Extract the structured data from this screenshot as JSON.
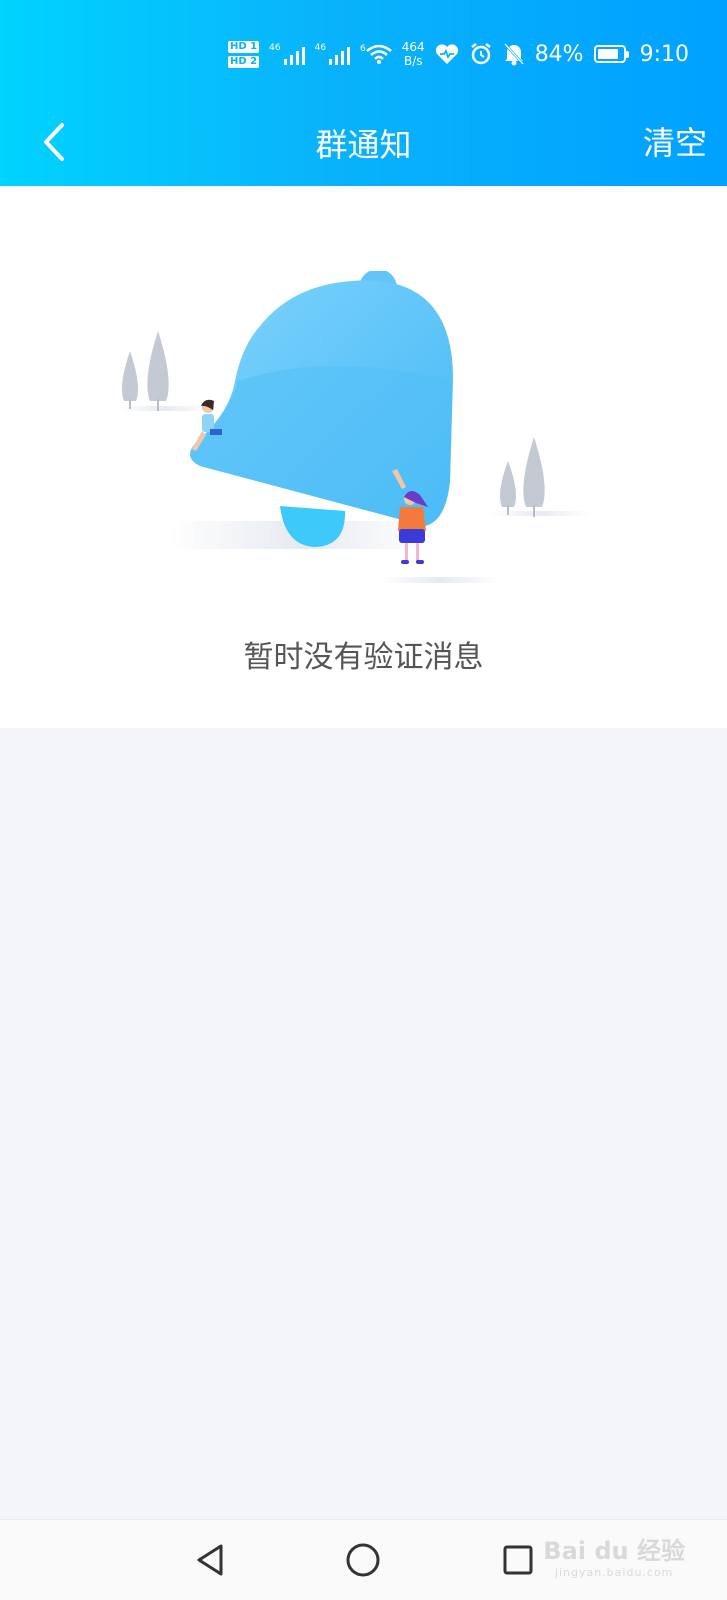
{
  "status_bar": {
    "hd1": "HD 1",
    "hd2": "HD 2",
    "signal1_label": "46",
    "signal2_label": "46",
    "wifi_label": "6",
    "net_speed_value": "464",
    "net_speed_unit": "B/s",
    "battery": "84%",
    "battery_level": 0.84,
    "time": "9:10"
  },
  "header": {
    "title": "群通知",
    "clear_label": "清空"
  },
  "empty_state": {
    "message": "暂时没有验证消息"
  },
  "watermark": {
    "brand": "Bai du 经验",
    "url": "jingyan.baidu.com"
  },
  "colors": {
    "header_start": "#00d3ff",
    "header_end": "#00a1ff",
    "bell": "#5cc6f8",
    "page_bg": "#f3f5f9"
  }
}
